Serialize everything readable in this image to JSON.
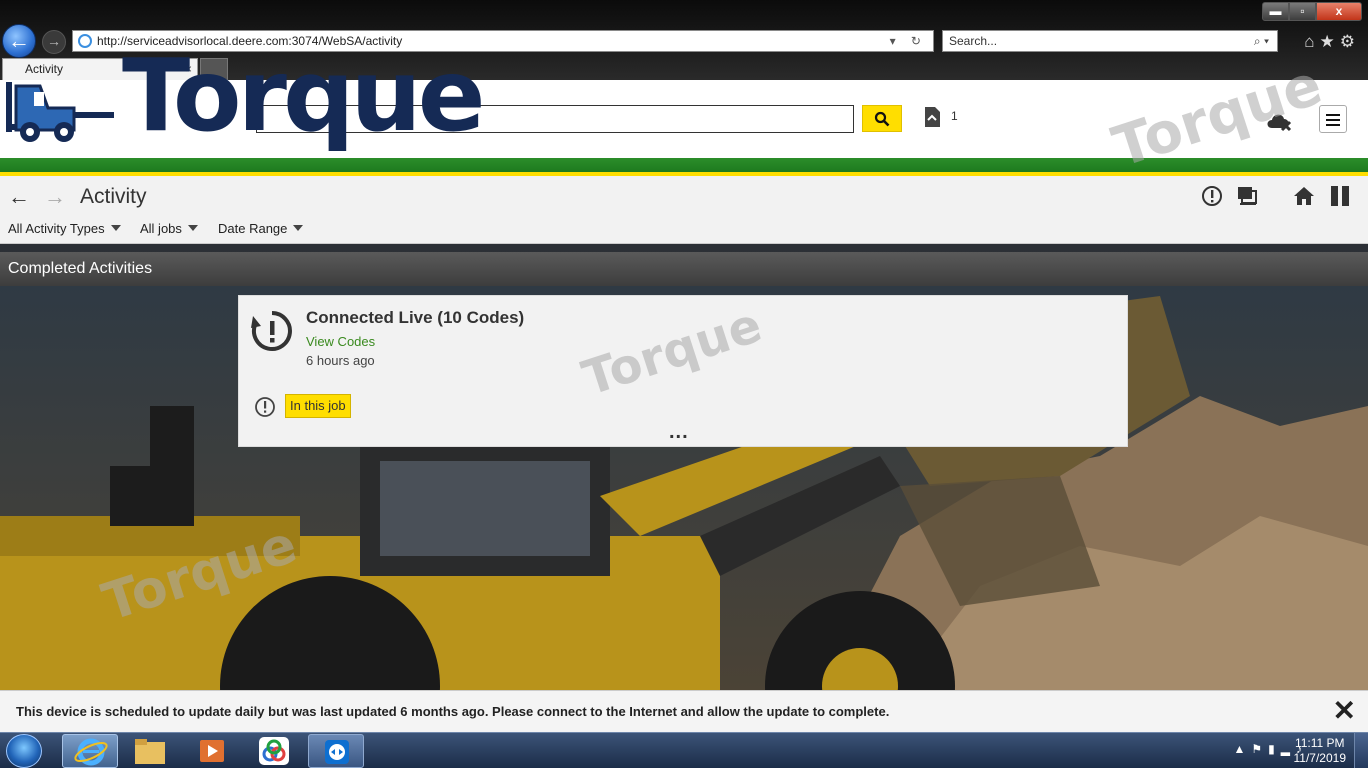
{
  "browser": {
    "url": "http://serviceadvisorlocal.deere.com:3074/WebSA/activity",
    "search_placeholder": "Search...",
    "tab_title": "Activity",
    "window_controls": {
      "minimize": "▬",
      "maximize": "▫",
      "close": "x"
    }
  },
  "logo": {
    "text": "Torque"
  },
  "header": {
    "search_value": "",
    "search_button_icon": "search-icon",
    "doc_count": "1"
  },
  "toolbar": {
    "back": "←",
    "forward": "→",
    "title": "Activity",
    "filters": {
      "types": "All Activity Types",
      "jobs": "All jobs",
      "date": "Date Range"
    }
  },
  "section": {
    "title": "Completed Activities"
  },
  "activity_card": {
    "title": "Connected Live (10 Codes)",
    "link": "View Codes",
    "time": "6 hours ago",
    "badge": "In this job",
    "more": "..."
  },
  "notice": {
    "text": "This device is scheduled to update daily but was last updated 6 months ago. Please connect to the Internet and allow the update to complete.",
    "close": "✕"
  },
  "taskbar": {
    "time": "11:11 PM",
    "date": "11/7/2019"
  },
  "colors": {
    "brand_navy": "#152a55",
    "deere_green": "#2c8d2a",
    "deere_yellow": "#ffde00",
    "link_green": "#3a8a1f"
  }
}
